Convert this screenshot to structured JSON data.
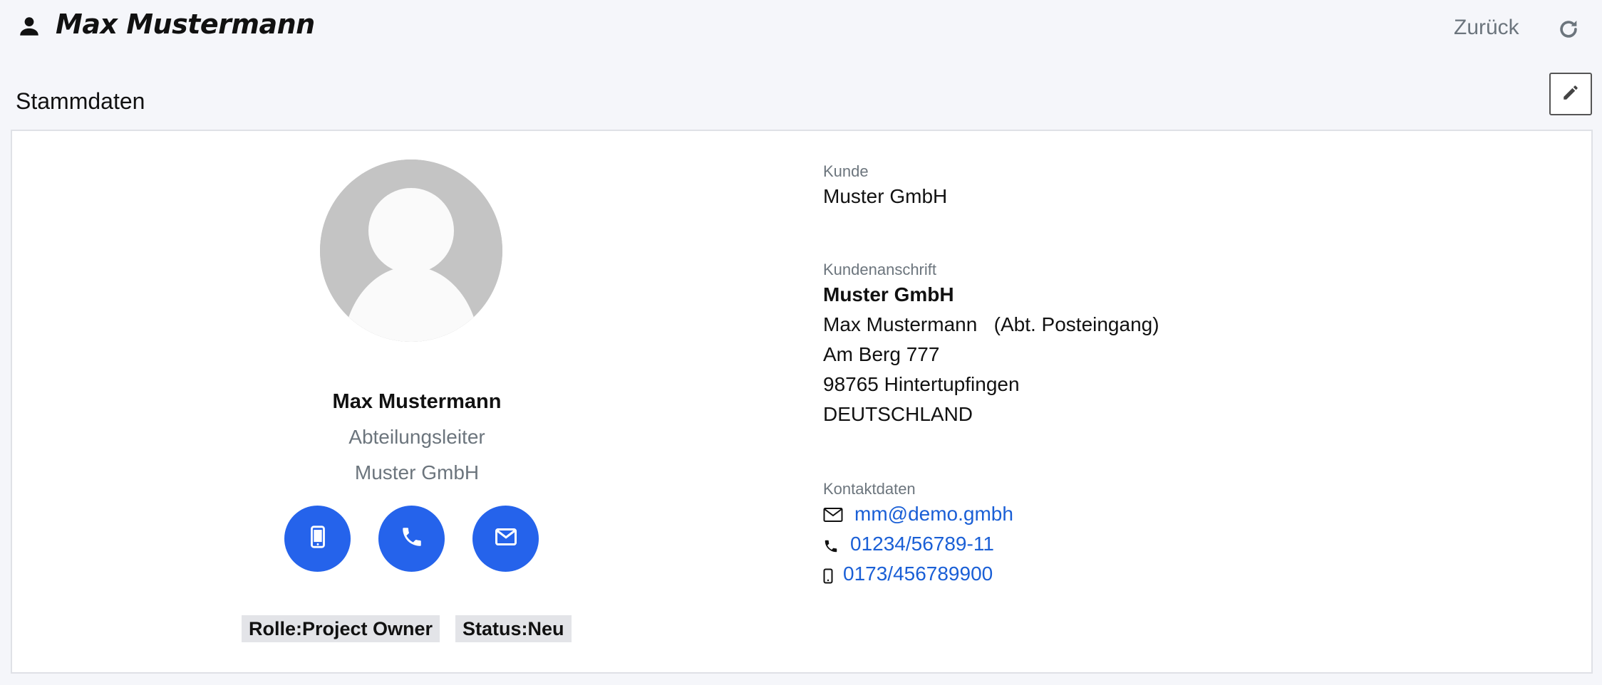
{
  "header": {
    "title": "Max Mustermann",
    "back_label": "Zurück"
  },
  "section": {
    "title": "Stammdaten"
  },
  "profile": {
    "name": "Max Mustermann",
    "position": "Abteilungsleiter",
    "company": "Muster GmbH",
    "role_badge": "Rolle:Project Owner",
    "status_badge": "Status:Neu"
  },
  "customer": {
    "label": "Kunde",
    "name": "Muster GmbH"
  },
  "address": {
    "label": "Kundenanschrift",
    "company": "Muster GmbH",
    "contact": "Max Mustermann   (Abt. Posteingang)",
    "street": "Am Berg 777",
    "city": "98765 Hintertupfingen",
    "country": "DEUTSCHLAND"
  },
  "contact": {
    "label": "Kontaktdaten",
    "email": "mm@demo.gmbh",
    "phone": "01234/56789-11",
    "mobile": "0173/456789900"
  },
  "colors": {
    "accent": "#2563eb",
    "link": "#1a5fd6",
    "muted": "#6c757d"
  },
  "icons": [
    "user-icon",
    "refresh-icon",
    "pencil-icon",
    "mobile-icon",
    "phone-icon",
    "mail-icon"
  ]
}
